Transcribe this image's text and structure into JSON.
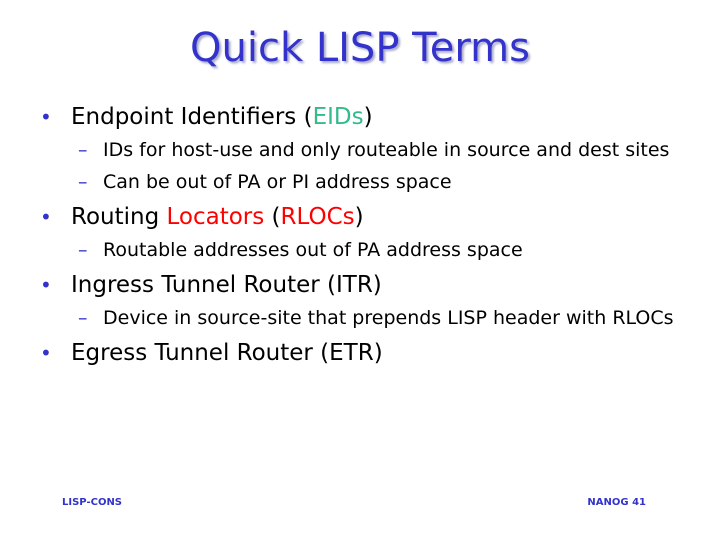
{
  "slide": {
    "title": "Quick LISP Terms",
    "bullet_glyph": "•",
    "dash_glyph": "–",
    "items": [
      {
        "pre": "Endpoint Identifiers (",
        "hl1": "",
        "mid": "",
        "hl2": "EIDs",
        "post": ")",
        "subs": [
          "IDs for host-use and only routeable in source and dest sites",
          "Can be out of PA or PI address space"
        ]
      },
      {
        "pre": "Routing ",
        "hl1": "Locators",
        "mid": " (",
        "hl2": "RLOCs",
        "post": ")",
        "subs": [
          "Routable addresses out of PA address space"
        ]
      },
      {
        "pre": "Ingress Tunnel Router (ITR)",
        "subs": [
          "Device in source-site that prepends LISP header with RLOCs"
        ]
      },
      {
        "pre": "Egress Tunnel Router (ETR)",
        "subs": []
      }
    ],
    "footer_left": "LISP-CONS",
    "footer_right": "NANOG 41"
  },
  "colors": {
    "title": "#3333cc",
    "eid_highlight": "#33bb88",
    "rloc_highlight": "#ff0000",
    "bullet": "#3333cc",
    "footer": "#3333cc"
  }
}
